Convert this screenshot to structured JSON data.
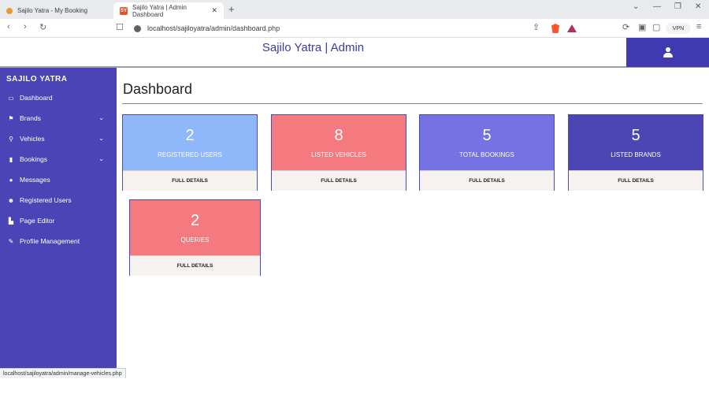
{
  "browser": {
    "tabs": [
      {
        "title": "Sajilo Yatra - My Booking",
        "active": false
      },
      {
        "title": "Sajilo Yatra | Admin Dashboard",
        "active": true
      }
    ],
    "url": "localhost/sajiloyatra/admin/dashboard.php",
    "vpn_label": "VPN",
    "status_url": "localhost/sajiloyatra/admin/manage-vehicles.php"
  },
  "header": {
    "title": "Sajilo Yatra | Admin"
  },
  "sidebar": {
    "brand": "SAJILO YATRA",
    "items": [
      {
        "label": "Dashboard",
        "icon": "monitor-icon",
        "expandable": false
      },
      {
        "label": "Brands",
        "icon": "flag-icon",
        "expandable": true
      },
      {
        "label": "Vehicles",
        "icon": "motorcycle-icon",
        "expandable": true
      },
      {
        "label": "Bookings",
        "icon": "book-icon",
        "expandable": true
      },
      {
        "label": "Messages",
        "icon": "comment-icon",
        "expandable": false
      },
      {
        "label": "Registered Users",
        "icon": "users-icon",
        "expandable": false
      },
      {
        "label": "Page Editor",
        "icon": "file-edit-icon",
        "expandable": false
      },
      {
        "label": "Profile Management",
        "icon": "edit-icon",
        "expandable": false
      }
    ]
  },
  "main": {
    "title": "Dashboard",
    "cards": [
      {
        "value": "2",
        "label": "REGISTERED USERS",
        "footer": "FULL DETAILS",
        "color": "#8fb8fb"
      },
      {
        "value": "8",
        "label": "LISTED VEHICLES",
        "footer": "FULL DETAILS",
        "color": "#f47a80"
      },
      {
        "value": "5",
        "label": "TOTAL BOOKINGS",
        "footer": "FULL DETAILS",
        "color": "#7573e3"
      },
      {
        "value": "5",
        "label": "LISTED BRANDS",
        "footer": "FULL DETAILS",
        "color": "#4c45b4"
      },
      {
        "value": "2",
        "label": "QUERIES",
        "footer": "FULL DETAILS",
        "color": "#f47a80"
      }
    ]
  }
}
